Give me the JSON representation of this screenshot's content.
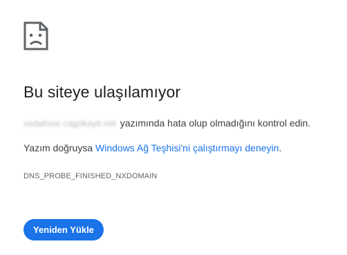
{
  "icon": "sad-page-icon",
  "title": "Bu siteye ulaşılamıyor",
  "message": {
    "url_blurred": "vodafone.cagrikayit.net",
    "line1_suffix": "yazımında hata olup olmadığını kontrol edin.",
    "line2_prefix": "Yazım doğruysa ",
    "line2_link": "Windows Ağ Teşhisi'ni çalıştırmayı deneyin",
    "line2_suffix": "."
  },
  "error_code": "DNS_PROBE_FINISHED_NXDOMAIN",
  "reload_button_label": "Yeniden Yükle",
  "colors": {
    "accent": "#1a73e8",
    "text": "#202124",
    "secondary_text": "#5f6368",
    "background": "#ffffff"
  }
}
